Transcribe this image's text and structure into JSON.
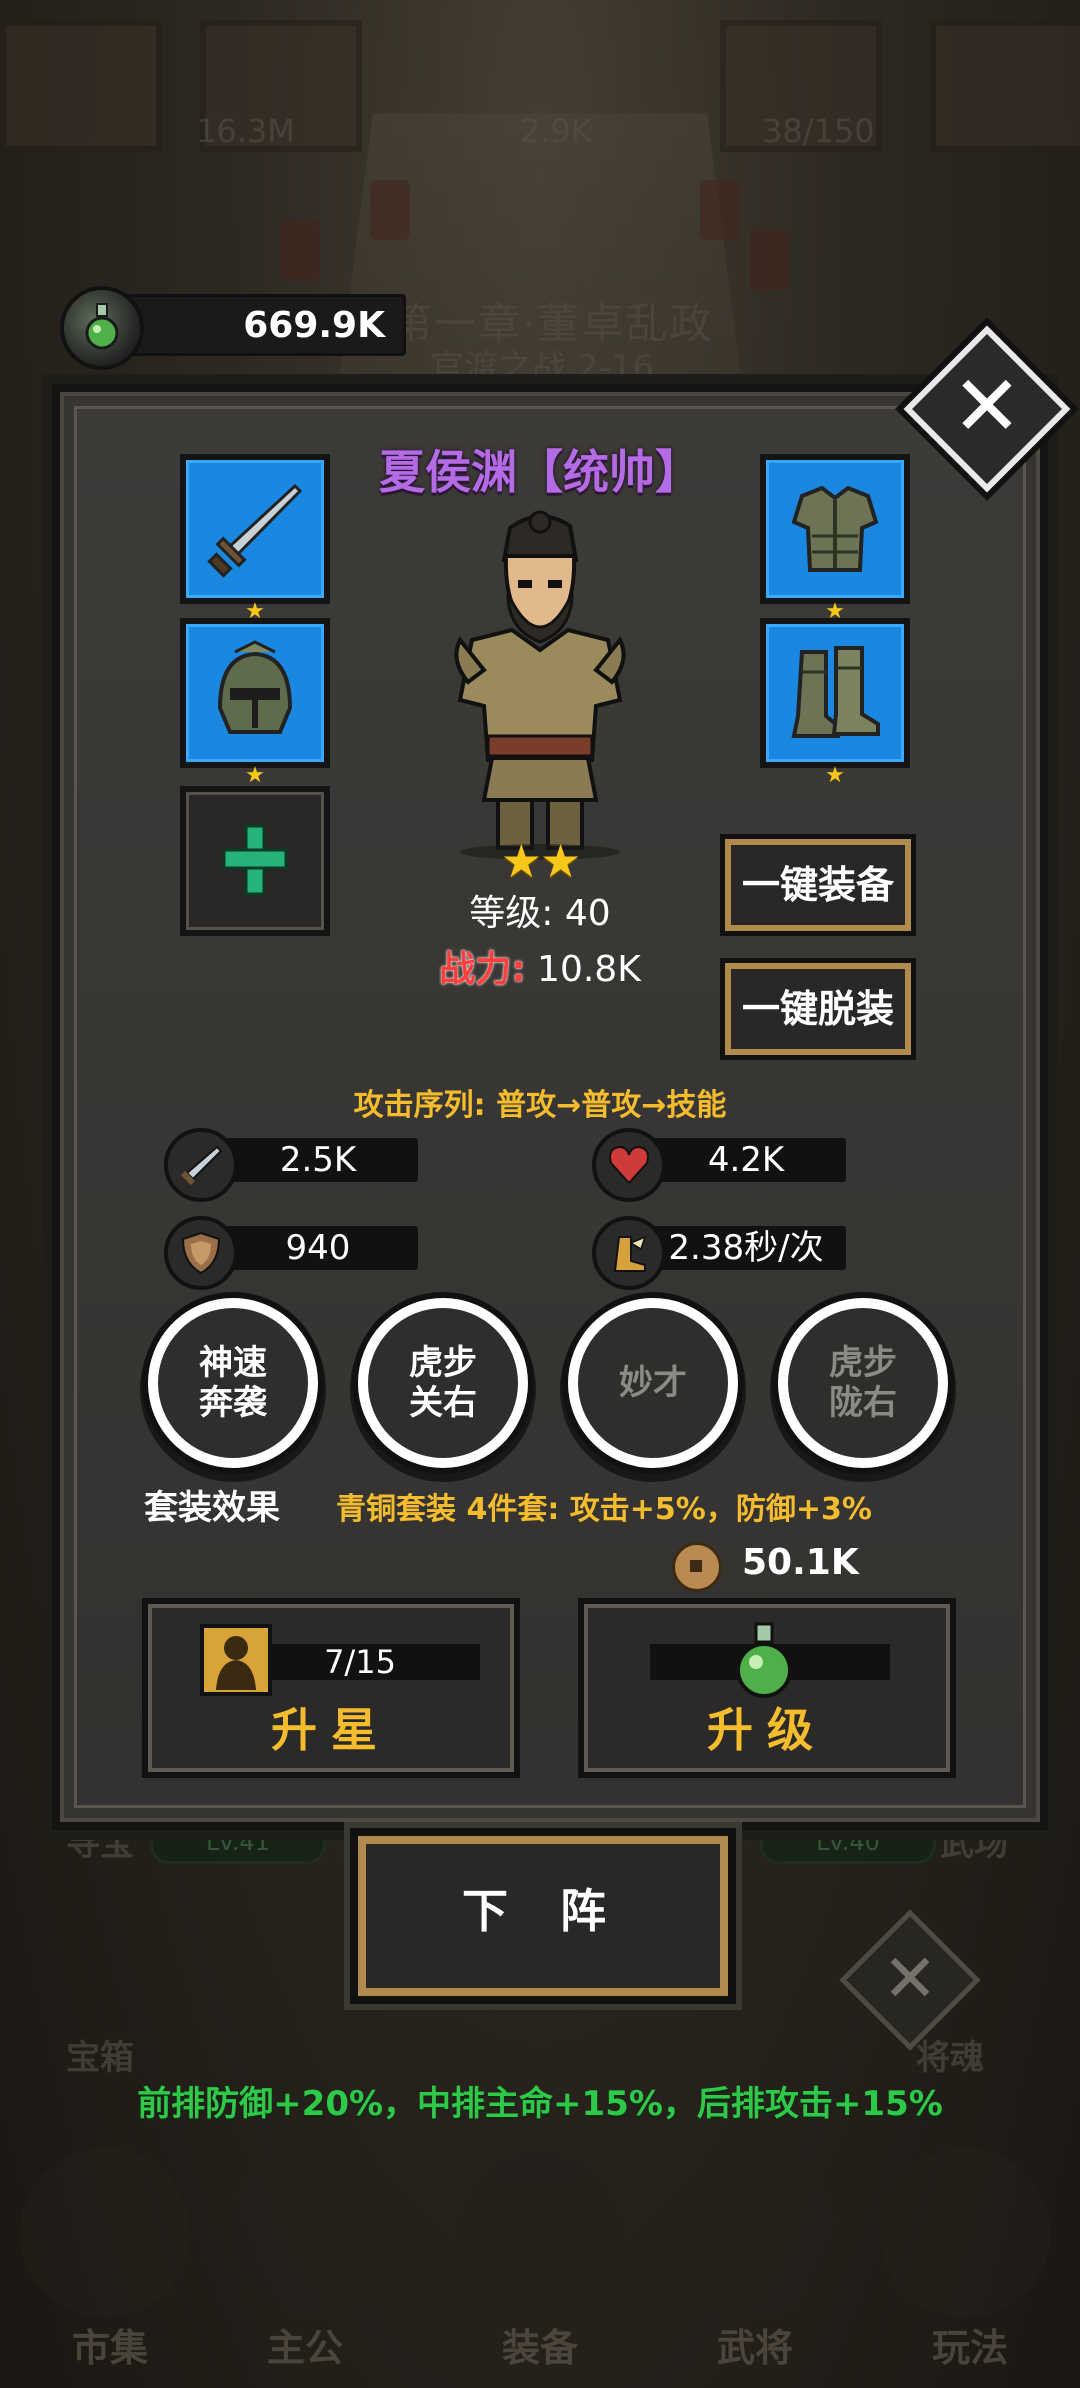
{
  "background": {
    "top_stats": [
      "16.3M",
      "2.9K",
      "38/150"
    ],
    "chapter_title": "第一章·董卓乱政",
    "chapter_stage": "官渡之战 2-16",
    "side_labels": {
      "left_top": "寻宝",
      "right_top": "武场",
      "left_mid": "宝箱",
      "right_mid": "将魂"
    },
    "lv_pills": [
      "Lv.41",
      "Lv.40"
    ],
    "formation_bonus": "前排防御+20%，中排主命+15%，后排攻击+15%",
    "nav": [
      "市集",
      "主公",
      "装备",
      "武将",
      "玩法"
    ]
  },
  "potion_counter": {
    "value": "669.9K"
  },
  "hero": {
    "name": "夏侯渊【统帅】",
    "stars": "★★",
    "level_label": "等级: 40",
    "power_label": "战力:",
    "power_value": "10.8K",
    "equipment": [
      {
        "slot": "weapon",
        "icon": "sword-icon",
        "stars": "★"
      },
      {
        "slot": "helmet",
        "icon": "helmet-icon",
        "stars": "★"
      },
      {
        "slot": "armor",
        "icon": "armor-icon",
        "stars": "★"
      },
      {
        "slot": "boots",
        "icon": "boots-icon",
        "stars": "★"
      }
    ]
  },
  "actions": {
    "equip_all": "一键装备",
    "unequip_all": "一键脱装"
  },
  "attack_sequence": "攻击序列: 普攻→普攻→技能",
  "stats": {
    "attack": "2.5K",
    "hp": "4.2K",
    "defense": "940",
    "speed": "2.38秒/次"
  },
  "skills": [
    {
      "name": "神速\n奔袭",
      "locked": false
    },
    {
      "name": "虎步\n关右",
      "locked": false
    },
    {
      "name": "妙才",
      "locked": true
    },
    {
      "name": "虎步\n陇右",
      "locked": true
    }
  ],
  "set_effect": {
    "label": "套装效果",
    "description": "青铜套装 4件套: 攻击+5%，防御+3%"
  },
  "upgrade": {
    "coin_cost": "50.1K",
    "star_up": {
      "progress": "7/15",
      "title": "升星"
    },
    "level_up": {
      "count": "0",
      "title": "升级"
    }
  },
  "deploy_button": "下 阵",
  "colors": {
    "accent_gold": "#f5bd2e",
    "equip_blue": "#1a88e0",
    "name_purple": "#b66be6",
    "power_red": "#ff3e3e"
  }
}
